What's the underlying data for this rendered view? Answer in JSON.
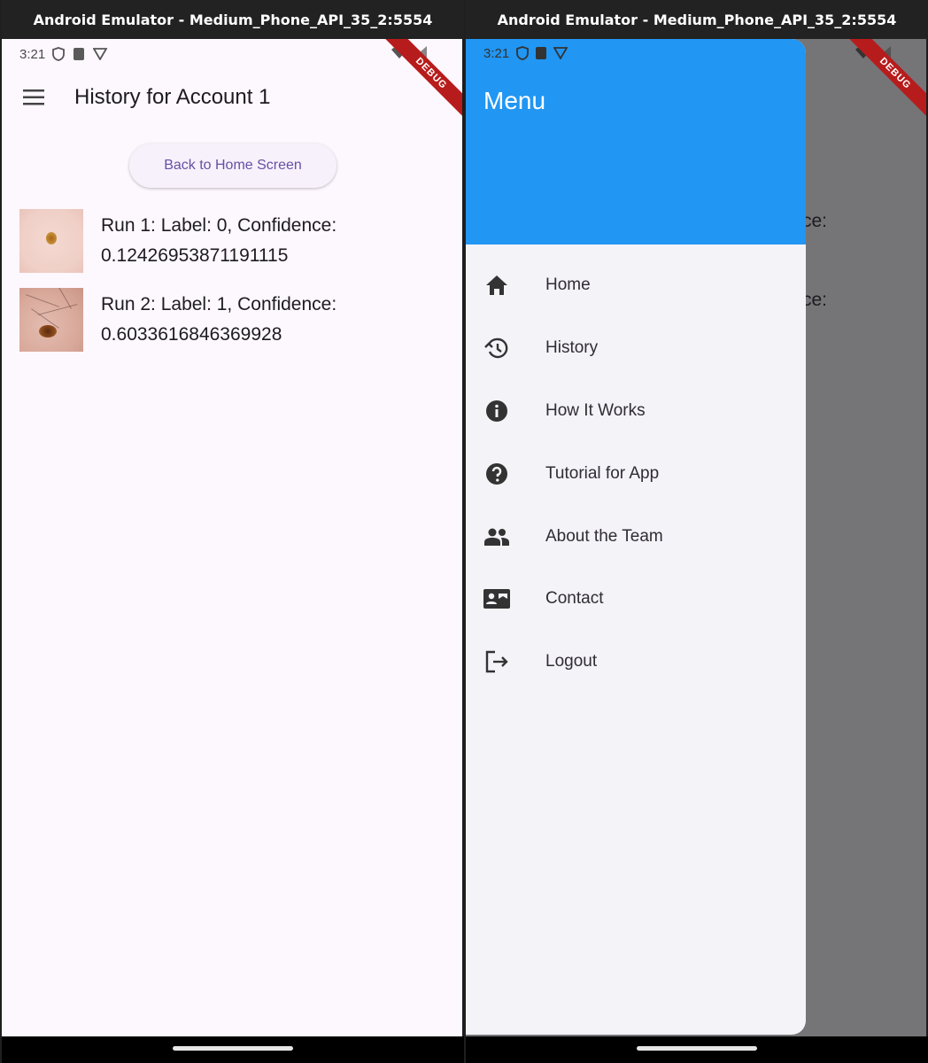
{
  "window": {
    "title": "Android Emulator - Medium_Phone_API_35_2:5554"
  },
  "status": {
    "time": "3:21",
    "debug_label": "DEBUG"
  },
  "history_screen": {
    "title": "History for Account 1",
    "back_button": "Back to Home Screen",
    "runs": [
      {
        "line1": "Run 1: Label: 0, Confidence:",
        "line2": "0.12426953871191115"
      },
      {
        "line1": "Run 2: Label: 1, Confidence:",
        "line2": "0.6033616846369928"
      }
    ]
  },
  "drawer": {
    "title": "Menu",
    "items": [
      {
        "label": "Home",
        "icon": "home-icon"
      },
      {
        "label": "History",
        "icon": "history-icon"
      },
      {
        "label": "How It Works",
        "icon": "info-icon"
      },
      {
        "label": "Tutorial for App",
        "icon": "help-icon"
      },
      {
        "label": "About the Team",
        "icon": "people-icon"
      },
      {
        "label": "Contact",
        "icon": "contact-card-icon"
      },
      {
        "label": "Logout",
        "icon": "logout-icon"
      }
    ],
    "peek": [
      "ce:",
      "ce:"
    ]
  },
  "colors": {
    "drawer_header": "#2196f3",
    "button_text": "#6750a4",
    "screen_bg": "#fdf7fe",
    "scrim": "#757477",
    "debug": "#b71c1c"
  }
}
